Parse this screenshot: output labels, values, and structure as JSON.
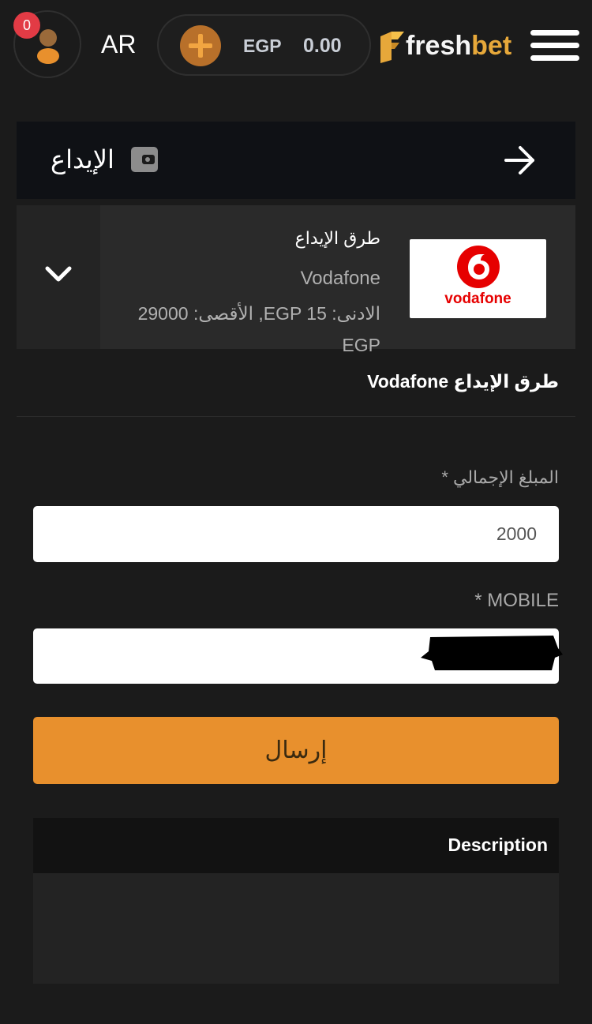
{
  "header": {
    "notification_count": "0",
    "language": "AR",
    "currency": "EGP",
    "balance": "0.00",
    "brand": {
      "part1": "fresh",
      "part2": "bet"
    }
  },
  "deposit": {
    "title": "الإيداع"
  },
  "method_card": {
    "heading": "طرق الإيداع",
    "name": "Vodafone",
    "limits": "الادنى: EGP 15,  الأقصى: 29000 EGP",
    "logo_text": "vodafone"
  },
  "selected_method": "طرق الإيداع Vodafone",
  "form": {
    "amount_label": "المبلغ الإجمالي *",
    "amount_value": "2000",
    "mobile_label": "* MOBILE",
    "mobile_value": "",
    "submit_label": "إرسال"
  },
  "description": {
    "title": "Description"
  },
  "colors": {
    "background": "#1b1b1b",
    "accent": "#e8902d",
    "badge": "#e23b45",
    "brand_orange": "#e7a83a",
    "vodafone_red": "#e60000"
  },
  "icons": {
    "avatar": "user-icon",
    "add": "plus-icon",
    "menu": "hamburger-menu-icon",
    "wallet": "wallet-icon",
    "back": "arrow-right-icon",
    "expand": "chevron-down-icon"
  }
}
